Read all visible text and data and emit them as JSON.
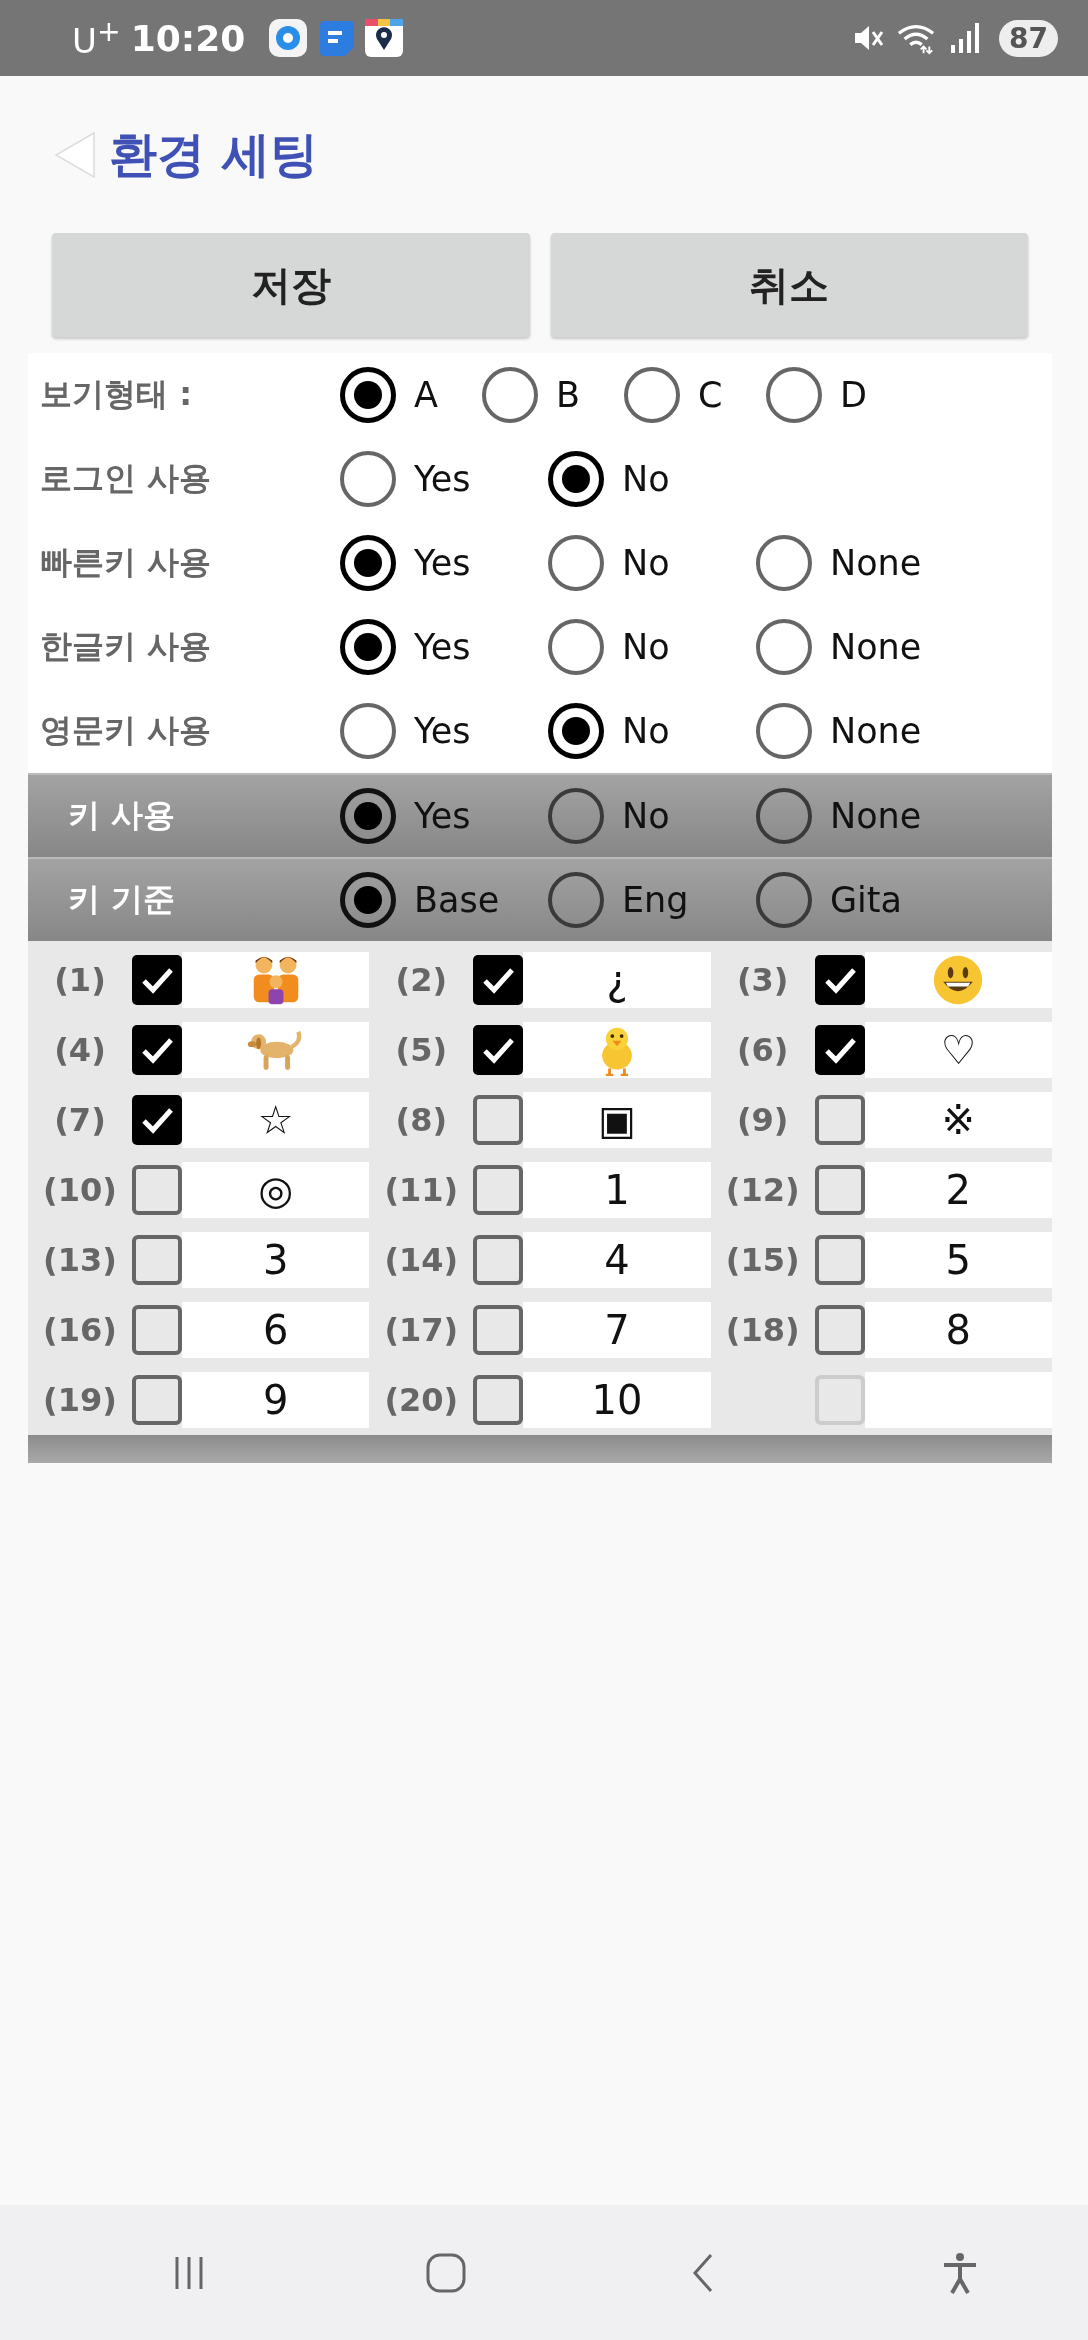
{
  "status_bar": {
    "carrier": "U$^{+}$",
    "time": "10:20",
    "battery": "87"
  },
  "header": {
    "title": "환경 세팅"
  },
  "buttons": [
    "저장",
    "취소"
  ],
  "settings": [
    {
      "label": "보기형태 :",
      "kind": "plain",
      "options": [
        {
          "label": "A",
          "selected": true
        },
        {
          "label": "B",
          "selected": false
        },
        {
          "label": "C",
          "selected": false
        },
        {
          "label": "D",
          "selected": false
        }
      ]
    },
    {
      "label": "로그인 사용",
      "kind": "plain",
      "options": [
        {
          "label": "Yes",
          "selected": false
        },
        {
          "label": "No",
          "selected": true
        }
      ]
    },
    {
      "label": "빠른키 사용",
      "kind": "plain",
      "options": [
        {
          "label": "Yes",
          "selected": true
        },
        {
          "label": "No",
          "selected": false
        },
        {
          "label": "None",
          "selected": false
        }
      ]
    },
    {
      "label": "한글키 사용",
      "kind": "plain",
      "options": [
        {
          "label": "Yes",
          "selected": true
        },
        {
          "label": "No",
          "selected": false
        },
        {
          "label": "None",
          "selected": false
        }
      ]
    },
    {
      "label": "영문키 사용",
      "kind": "plain",
      "options": [
        {
          "label": "Yes",
          "selected": false
        },
        {
          "label": "No",
          "selected": true
        },
        {
          "label": "None",
          "selected": false
        }
      ]
    },
    {
      "label": "키 사용",
      "kind": "header",
      "options": [
        {
          "label": "Yes",
          "selected": true
        },
        {
          "label": "No",
          "selected": false
        },
        {
          "label": "None",
          "selected": false
        }
      ]
    },
    {
      "label": "키 기준",
      "kind": "header",
      "options": [
        {
          "label": "Base",
          "selected": true
        },
        {
          "label": "Eng",
          "selected": false
        },
        {
          "label": "Gita",
          "selected": false
        }
      ]
    }
  ],
  "keys": [
    {
      "number": "(1)",
      "checked": true,
      "disabled": false,
      "kind": "family"
    },
    {
      "number": "(2)",
      "checked": true,
      "disabled": false,
      "kind": "text",
      "value": "¿"
    },
    {
      "number": "(3)",
      "checked": true,
      "disabled": false,
      "kind": "smiley"
    },
    {
      "number": "(4)",
      "checked": true,
      "disabled": false,
      "kind": "dog"
    },
    {
      "number": "(5)",
      "checked": true,
      "disabled": false,
      "kind": "chick"
    },
    {
      "number": "(6)",
      "checked": true,
      "disabled": false,
      "kind": "text",
      "value": "♡"
    },
    {
      "number": "(7)",
      "checked": true,
      "disabled": false,
      "kind": "text",
      "value": "☆"
    },
    {
      "number": "(8)",
      "checked": false,
      "disabled": false,
      "kind": "text",
      "value": "▣"
    },
    {
      "number": "(9)",
      "checked": false,
      "disabled": false,
      "kind": "text",
      "value": "※"
    },
    {
      "number": "(10)",
      "checked": false,
      "disabled": false,
      "kind": "text",
      "value": "◎"
    },
    {
      "number": "(11)",
      "checked": false,
      "disabled": false,
      "kind": "text",
      "value": "1"
    },
    {
      "number": "(12)",
      "checked": false,
      "disabled": false,
      "kind": "text",
      "value": "2"
    },
    {
      "number": "(13)",
      "checked": false,
      "disabled": false,
      "kind": "text",
      "value": "3"
    },
    {
      "number": "(14)",
      "checked": false,
      "disabled": false,
      "kind": "text",
      "value": "4"
    },
    {
      "number": "(15)",
      "checked": false,
      "disabled": false,
      "kind": "text",
      "value": "5"
    },
    {
      "number": "(16)",
      "checked": false,
      "disabled": false,
      "kind": "text",
      "value": "6"
    },
    {
      "number": "(17)",
      "checked": false,
      "disabled": false,
      "kind": "text",
      "value": "7"
    },
    {
      "number": "(18)",
      "checked": false,
      "disabled": false,
      "kind": "text",
      "value": "8"
    },
    {
      "number": "(19)",
      "checked": false,
      "disabled": false,
      "kind": "text",
      "value": "9"
    },
    {
      "number": "(20)",
      "checked": false,
      "disabled": false,
      "kind": "text",
      "value": "10"
    },
    {
      "checked": false,
      "disabled": true,
      "kind": "empty"
    }
  ]
}
